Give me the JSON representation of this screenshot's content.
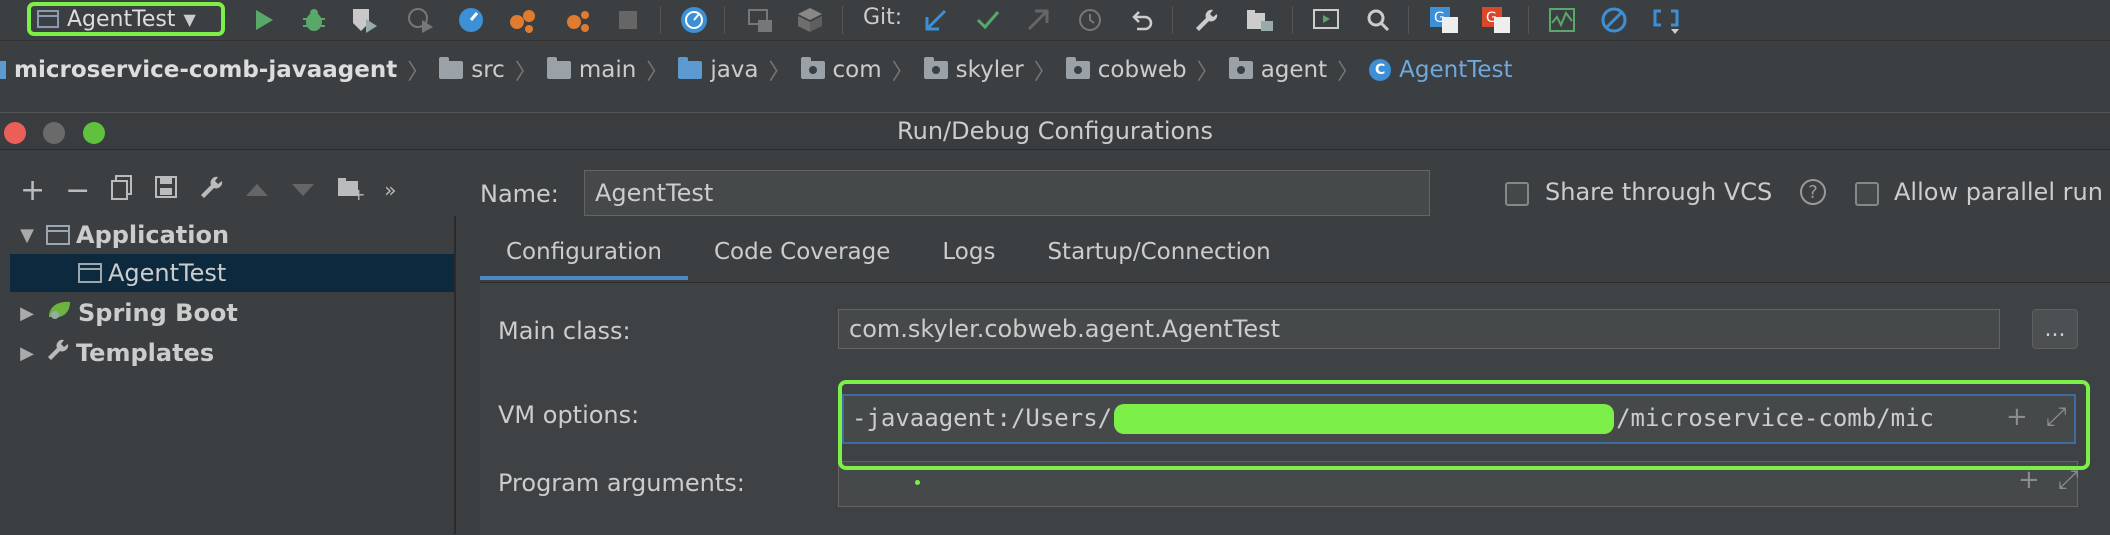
{
  "toolbar": {
    "run_config": "AgentTest",
    "git_label": "Git:",
    "colors": {
      "highlight": "#7cf048",
      "run_green": "#59a869",
      "debug_green": "#59a869",
      "accent_blue": "#3d8fd6"
    }
  },
  "breadcrumbs": [
    {
      "label": "microservice-comb-javaagent",
      "icon": "project-icon"
    },
    {
      "label": "src",
      "icon": "folder-icon"
    },
    {
      "label": "main",
      "icon": "folder-icon"
    },
    {
      "label": "java",
      "icon": "source-folder-icon"
    },
    {
      "label": "com",
      "icon": "package-icon"
    },
    {
      "label": "skyler",
      "icon": "package-icon"
    },
    {
      "label": "cobweb",
      "icon": "package-icon"
    },
    {
      "label": "agent",
      "icon": "package-icon"
    },
    {
      "label": "AgentTest",
      "icon": "class-icon"
    }
  ],
  "dialog": {
    "title": "Run/Debug Configurations",
    "name_label": "Name:",
    "name_value": "AgentTest",
    "share_label": "Share through VCS",
    "parallel_label": "Allow parallel run",
    "tree": {
      "application": "Application",
      "agenttest": "AgentTest",
      "spring_boot": "Spring Boot",
      "templates": "Templates"
    },
    "tabs": [
      "Configuration",
      "Code Coverage",
      "Logs",
      "Startup/Connection"
    ],
    "main_class_label": "Main class:",
    "main_class_value": "com.skyler.cobweb.agent.AgentTest",
    "dots_label": "...",
    "vm_options_label": "VM options:",
    "vm_prefix": "-javaagent:/Users/",
    "vm_suffix": "/microservice-comb/mic",
    "program_args_label": "Program arguments:"
  }
}
